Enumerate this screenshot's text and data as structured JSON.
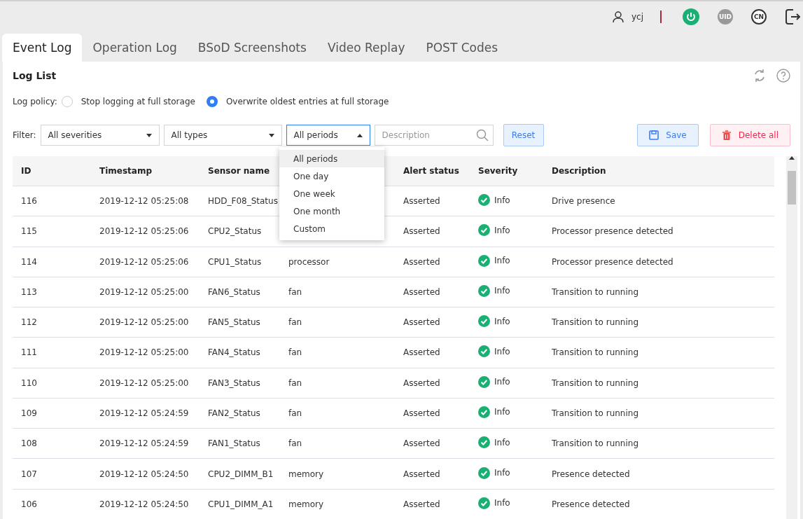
{
  "header": {
    "user": "ycj",
    "uid_label": "UID",
    "lang_label": "CN"
  },
  "tabs": [
    {
      "label": "Event Log",
      "selected": true
    },
    {
      "label": "Operation Log",
      "selected": false
    },
    {
      "label": "BSoD Screenshots",
      "selected": false
    },
    {
      "label": "Video Replay",
      "selected": false
    },
    {
      "label": "POST Codes",
      "selected": false
    }
  ],
  "panel": {
    "title": "Log List"
  },
  "log_policy": {
    "label": "Log policy:",
    "options": [
      {
        "label": "Stop logging at full storage",
        "selected": false
      },
      {
        "label": "Overwrite oldest entries at full storage",
        "selected": true
      }
    ]
  },
  "filter": {
    "label": "Filter:",
    "severity": "All severities",
    "type": "All types",
    "period": {
      "value": "All periods",
      "expanded": true,
      "options": [
        {
          "label": "All periods",
          "selected": true
        },
        {
          "label": "One day",
          "selected": false
        },
        {
          "label": "One week",
          "selected": false
        },
        {
          "label": "One month",
          "selected": false
        },
        {
          "label": "Custom",
          "selected": false
        }
      ]
    },
    "search": {
      "placeholder": "Description"
    },
    "reset": "Reset",
    "save": "Save",
    "delete_all": "Delete all"
  },
  "table": {
    "columns": [
      "ID",
      "Timestamp",
      "Sensor name",
      null,
      "Alert status",
      "Severity",
      "Description"
    ],
    "rows": [
      {
        "id": "116",
        "timestamp": "2019-12-12 05:25:08",
        "sensor": "HDD_F08_Status",
        "alert": "Asserted",
        "severity": "Info",
        "description": "Drive presence"
      },
      {
        "id": "115",
        "timestamp": "2019-12-12 05:25:06",
        "sensor": "CPU2_Status",
        "alert": "Asserted",
        "severity": "Info",
        "description": "Processor presence detected"
      },
      {
        "id": "114",
        "timestamp": "2019-12-12 05:25:06",
        "sensor": "CPU1_Status",
        "column_4": "processor",
        "alert": "Asserted",
        "severity": "Info",
        "description": "Processor presence detected"
      },
      {
        "id": "113",
        "timestamp": "2019-12-12 05:25:00",
        "sensor": "FAN6_Status",
        "column_4": "fan",
        "alert": "Asserted",
        "severity": "Info",
        "description": "Transition to running"
      },
      {
        "id": "112",
        "timestamp": "2019-12-12 05:25:00",
        "sensor": "FAN5_Status",
        "column_4": "fan",
        "alert": "Asserted",
        "severity": "Info",
        "description": "Transition to running"
      },
      {
        "id": "111",
        "timestamp": "2019-12-12 05:25:00",
        "sensor": "FAN4_Status",
        "column_4": "fan",
        "alert": "Asserted",
        "severity": "Info",
        "description": "Transition to running"
      },
      {
        "id": "110",
        "timestamp": "2019-12-12 05:25:00",
        "sensor": "FAN3_Status",
        "column_4": "fan",
        "alert": "Asserted",
        "severity": "Info",
        "description": "Transition to running"
      },
      {
        "id": "109",
        "timestamp": "2019-12-12 05:24:59",
        "sensor": "FAN2_Status",
        "column_4": "fan",
        "alert": "Asserted",
        "severity": "Info",
        "description": "Transition to running"
      },
      {
        "id": "108",
        "timestamp": "2019-12-12 05:24:59",
        "sensor": "FAN1_Status",
        "column_4": "fan",
        "alert": "Asserted",
        "severity": "Info",
        "description": "Transition to running"
      },
      {
        "id": "107",
        "timestamp": "2019-12-12 05:24:50",
        "sensor": "CPU2_DIMM_B1",
        "column_4": "memory",
        "alert": "Asserted",
        "severity": "Info",
        "description": "Presence detected"
      },
      {
        "id": "106",
        "timestamp": "2019-12-12 05:24:50",
        "sensor": "CPU1_DIMM_A1",
        "column_4": "memory",
        "alert": "Asserted",
        "severity": "Info",
        "description": "Presence detected"
      }
    ]
  }
}
